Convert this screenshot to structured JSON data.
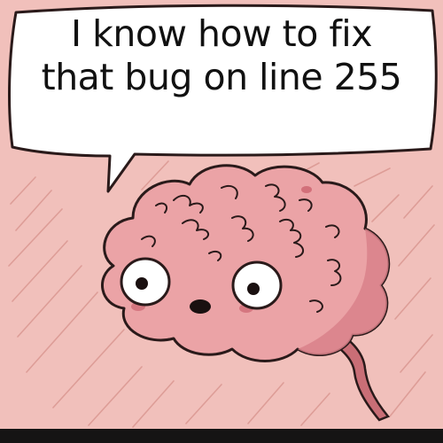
{
  "meme": {
    "caption_lines": [
      "I know how to fix",
      "that bug on line 255"
    ]
  },
  "colors": {
    "background_pink": "#f1c0bb",
    "brain_pink": "#eba3a6",
    "brain_shadow": "#c96e76",
    "outline": "#2a1a1a",
    "bubble_fill": "#ffffff"
  },
  "icons": {
    "character": "brain-icon",
    "bubble": "speech-bubble-icon"
  }
}
